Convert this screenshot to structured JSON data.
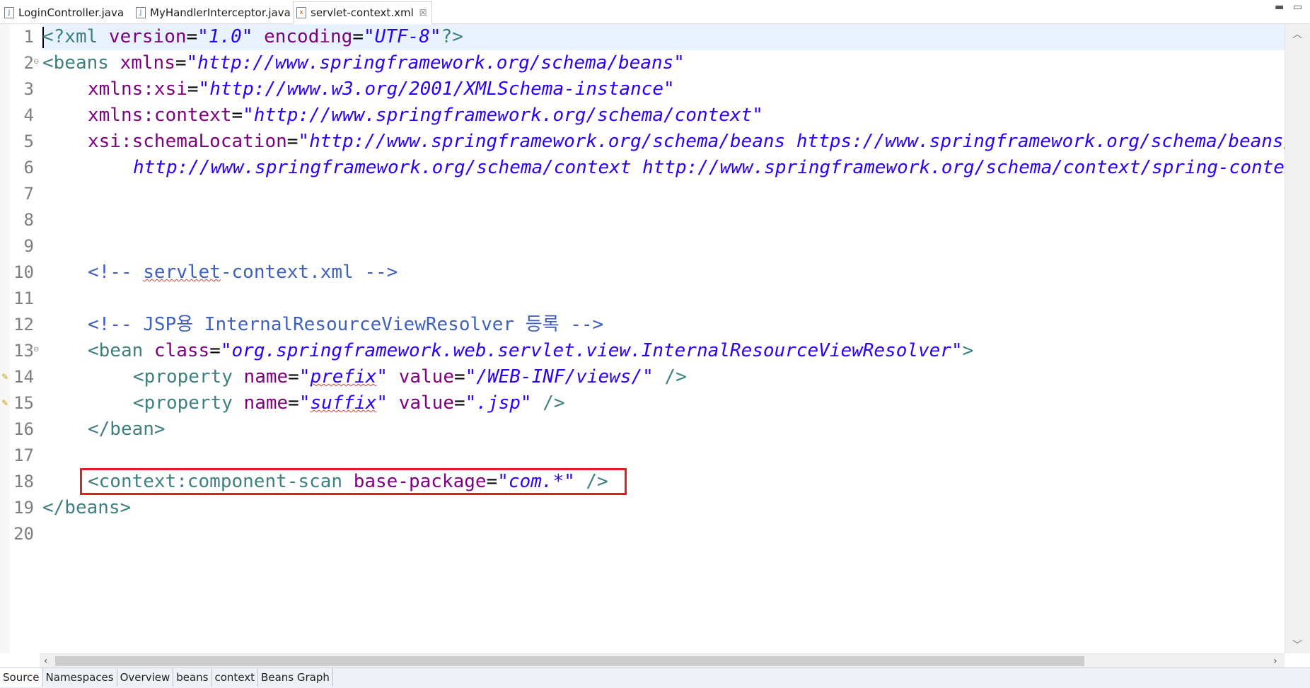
{
  "tabs": [
    {
      "label": "LoginController.java",
      "icon": "java-file-icon"
    },
    {
      "label": "MyHandlerInterceptor.java",
      "icon": "java-file-icon"
    },
    {
      "label": "servlet-context.xml",
      "icon": "xml-file-icon",
      "close": "☒"
    }
  ],
  "window_controls": {
    "minimize": "▬",
    "maximize": "▭"
  },
  "line_numbers": [
    "1",
    "2",
    "3",
    "4",
    "5",
    "6",
    "7",
    "8",
    "9",
    "10",
    "11",
    "12",
    "13",
    "14",
    "15",
    "16",
    "17",
    "18",
    "19",
    "20"
  ],
  "code": {
    "l1": {
      "open": "<?xml ",
      "a1": "version",
      "eq1": "=",
      "v1": "\"1.0\"",
      "sp": " ",
      "a2": "encoding",
      "eq2": "=",
      "v2": "\"UTF-8\"",
      "close": "?>"
    },
    "l2": {
      "open": "<beans ",
      "a1": "xmlns",
      "eq": "=",
      "v1": "\"http://www.springframework.org/schema/beans\""
    },
    "l3": {
      "a": "xmlns:xsi",
      "eq": "=",
      "v": "\"http://www.w3.org/2001/XMLSchema-instance\""
    },
    "l4": {
      "a": "xmlns:context",
      "eq": "=",
      "v": "\"http://www.springframework.org/schema/context\""
    },
    "l5": {
      "a": "xsi:schemaLocation",
      "eq": "=",
      "v": "\"http://www.springframework.org/schema/beans https://www.springframework.org/schema/beans/spring-beans.xsd"
    },
    "l6": {
      "v": "http://www.springframework.org/schema/context http://www.springframework.org/schema/context/spring-context.xsd\">"
    },
    "l10": {
      "c1": "<!-- ",
      "c2": "servlet",
      "c3": "-context.xml -->"
    },
    "l12": {
      "c": "<!-- JSP용 InternalResourceViewResolver 등록 -->"
    },
    "l13": {
      "open": "<bean ",
      "a": "class",
      "eq": "=",
      "v": "\"org.springframework.web.servlet.view.InternalResourceViewResolver\"",
      "close": ">"
    },
    "l14": {
      "open": "<property ",
      "a1": "name",
      "eq1": "=",
      "v1q": "\"",
      "v1": "prefix",
      "v1e": "\"",
      "sp": " ",
      "a2": "value",
      "eq2": "=",
      "v2": "\"/WEB-INF/views/\"",
      "close": " />"
    },
    "l15": {
      "open": "<property ",
      "a1": "name",
      "eq1": "=",
      "v1q": "\"",
      "v1": "suffix",
      "v1e": "\"",
      "sp": " ",
      "a2": "value",
      "eq2": "=",
      "v2": "\".jsp\"",
      "close": " />"
    },
    "l16": {
      "t": "</bean>"
    },
    "l18": {
      "open": "<context:component-scan ",
      "a": "base-package",
      "eq": "=",
      "v": "\"com.*\"",
      "close": " />"
    },
    "l19": {
      "t": "</beans>"
    }
  },
  "bottom_tabs": [
    "Source",
    "Namespaces",
    "Overview",
    "beans",
    "context",
    "Beans Graph"
  ],
  "colors": {
    "tag": "#3f7f7f",
    "attribute": "#7f007f",
    "value": "#2a00ff",
    "comment": "#3f5fbf",
    "highlight_box": "#e02020"
  }
}
